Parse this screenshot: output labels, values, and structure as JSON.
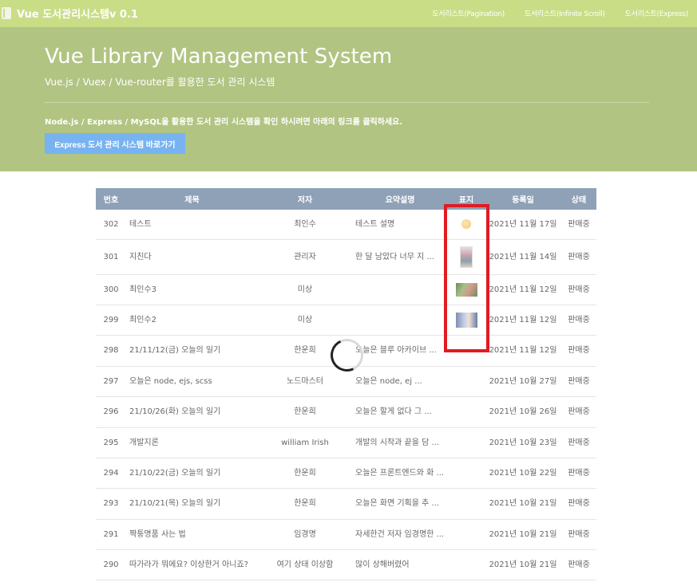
{
  "navbar": {
    "brand": "Vue 도서관리시스템v 0.1",
    "links": [
      "도서리스트(Pagination)",
      "도서리스트(Infinite Scroll)",
      "도서리스트(Express)"
    ]
  },
  "jumbotron": {
    "title": "Vue Library Management System",
    "subtitle": "Vue.js / Vuex / Vue-router를 활용한 도서 관리 시스템",
    "notice": "Node.js / Express / MySQL을 활용한 도서 관리 시스템을 확인 하시려면 아래의 링크를 클릭하세요.",
    "button": "Express 도서 관리 시스템 바로가기"
  },
  "table": {
    "headers": [
      "번호",
      "제목",
      "저자",
      "요약설명",
      "표지",
      "등록일",
      "상태"
    ],
    "rows": [
      {
        "no": "302",
        "title": "테스트",
        "author": "최인수",
        "summary": "테스트 설명",
        "cover": "circle",
        "date": "2021년 11월 17일",
        "status": "판매중"
      },
      {
        "no": "301",
        "title": "지친다",
        "author": "관리자",
        "summary": "한 달 남았다 너무 지 ...",
        "cover": "portrait",
        "date": "2021년 11월 14일",
        "status": "판매중"
      },
      {
        "no": "300",
        "title": "최인수3",
        "author": "미상",
        "summary": "",
        "cover": "landscape",
        "date": "2021년 11월 12일",
        "status": "판매중"
      },
      {
        "no": "299",
        "title": "최인수2",
        "author": "미상",
        "summary": "",
        "cover": "face",
        "date": "2021년 11월 12일",
        "status": "판매중"
      },
      {
        "no": "298",
        "title": "21/11/12(금) 오늘의 일기",
        "author": "한운희",
        "summary": "오늘은 블루 아카이브 ...",
        "cover": "",
        "date": "2021년 11월 12일",
        "status": "판매중"
      },
      {
        "no": "297",
        "title": "오늘은 node, ejs, scss",
        "author": "노드마스터",
        "summary": "오늘은 node, ej ...",
        "cover": "",
        "date": "2021년 10월 27일",
        "status": "판매중"
      },
      {
        "no": "296",
        "title": "21/10/26(화) 오늘의 일기",
        "author": "한운희",
        "summary": "오늘은 할게 없다 그 ...",
        "cover": "",
        "date": "2021년 10월 26일",
        "status": "판매중"
      },
      {
        "no": "295",
        "title": "개발지론",
        "author": "william Irish",
        "summary": "개발의 시작과 끝을 담 ...",
        "cover": "",
        "date": "2021년 10월 23일",
        "status": "판매중"
      },
      {
        "no": "294",
        "title": "21/10/22(금) 오늘의 일기",
        "author": "한운희",
        "summary": "오늘은 프론트엔드와 화 ...",
        "cover": "",
        "date": "2021년 10월 22일",
        "status": "판매중"
      },
      {
        "no": "293",
        "title": "21/10/21(목) 오늘의 일기",
        "author": "한운희",
        "summary": "오늘은 화면 기획을 추 ...",
        "cover": "",
        "date": "2021년 10월 21일",
        "status": "판매중"
      },
      {
        "no": "291",
        "title": "짝퉁명품 사는 법",
        "author": "임경명",
        "summary": "자세한건 저자 임경명한 ...",
        "cover": "",
        "date": "2021년 10월 21일",
        "status": "판매중"
      },
      {
        "no": "290",
        "title": "따가라가 뭐에요? 이상한거 아니죠?",
        "author": "여기 상태 이상함",
        "summary": "많이 상해버렸어",
        "cover": "",
        "date": "2021년 10월 21일",
        "status": "판매중"
      }
    ]
  }
}
